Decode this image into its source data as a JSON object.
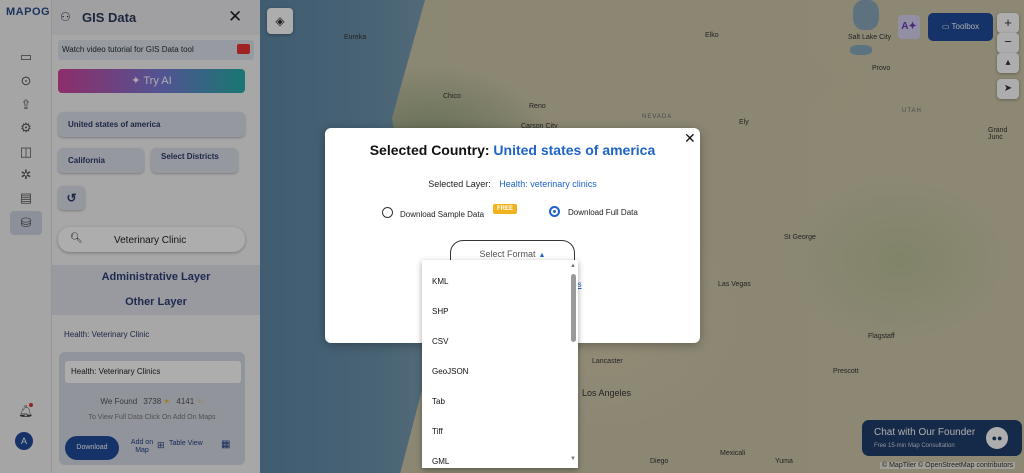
{
  "app": {
    "logo": "MAPOG",
    "panel_title": "GIS Data"
  },
  "panel": {
    "video_text": "Watch video tutorial for GIS Data tool",
    "try_ai": "Try AI",
    "country_button": "United states of america",
    "state_button": "California",
    "districts_button": "Select Districts",
    "search_value": "Veterinary Clinic",
    "admin_layer": "Administrative Layer",
    "other_layer": "Other Layer",
    "layer_label": "Health: Veterinary Clinic",
    "card": {
      "input_value": "Health: Veterinary Clinics",
      "found_prefix": "We Found",
      "count1": "3738",
      "count2": "4141",
      "hint": "To View Full Data Click On Add On Maps",
      "download": "Download",
      "add_on_map": "Add on Map",
      "table_view": "Table View"
    },
    "avatar_letter": "A"
  },
  "map": {
    "labels": [
      "Eureka",
      "Chico",
      "Reno",
      "Carson City",
      "NEVADA",
      "Elko",
      "Salt Lake City",
      "Provo",
      "UTAH",
      "Ely",
      "St George",
      "Las Vegas",
      "Grand Junc",
      "Flagstaff",
      "Prescott",
      "Lancaster",
      "Los Angeles",
      "Diego",
      "Yuma",
      "Mexicali"
    ],
    "toolbox": "Toolbox",
    "chat_title": "Chat with Our Founder",
    "chat_sub": "Free 15-min Map Consultation",
    "attribution": "© MapTiler © OpenStreetMap contributors"
  },
  "modal": {
    "title_prefix": "Selected Country:",
    "country": "United states of america",
    "layer_prefix": "Selected Layer:",
    "layer": "Health: veterinary clinics",
    "sample": "Download Sample Data",
    "free_badge": "FREE",
    "full": "Download Full Data",
    "select_format": "Select Format",
    "link_fragment": "es"
  },
  "formats": [
    "KML",
    "SHP",
    "CSV",
    "GeoJSON",
    "Tab",
    "Tiff",
    "GML"
  ]
}
